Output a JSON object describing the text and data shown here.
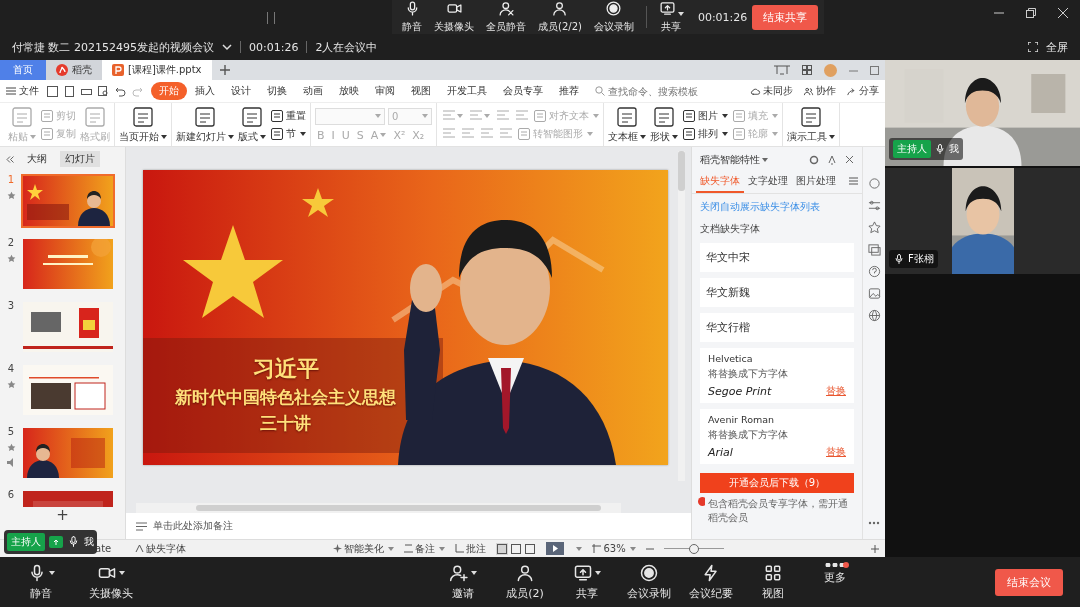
{
  "meeting_toolbar": {
    "buttons": [
      {
        "kind": "mic",
        "label": "静音",
        "dropdown": false
      },
      {
        "kind": "camera",
        "label": "关摄像头",
        "dropdown": false
      },
      {
        "kind": "mute_all",
        "label": "全员静音",
        "dropdown": false
      },
      {
        "kind": "members",
        "label": "成员(2/2)",
        "dropdown": false
      },
      {
        "kind": "record",
        "label": "会议录制",
        "dropdown": false
      },
      {
        "kind": "share",
        "label": "共享",
        "dropdown": true
      }
    ],
    "timer": "00:01:26",
    "end_button": "结束共享"
  },
  "meeting_info": {
    "title": "付常捷 数二 202152495发起的视频会议",
    "elapsed": "00:01:26",
    "participants": "2人在会议中",
    "fullscreen": "全屏"
  },
  "document_tabs": [
    {
      "kind": "home",
      "label": "首页",
      "selected": false
    },
    {
      "kind": "docer",
      "label": "稻壳",
      "selected": false
    },
    {
      "kind": "pptx",
      "label": "[课程]课件.pptx",
      "selected": true
    }
  ],
  "menu": {
    "file": "文件",
    "tabs": [
      {
        "label": "开始",
        "selected": true
      },
      {
        "label": "插入",
        "selected": false
      },
      {
        "label": "设计",
        "selected": false
      },
      {
        "label": "切换",
        "selected": false
      },
      {
        "label": "动画",
        "selected": false
      },
      {
        "label": "放映",
        "selected": false
      },
      {
        "label": "审阅",
        "selected": false
      },
      {
        "label": "视图",
        "selected": false
      },
      {
        "label": "开发工具",
        "selected": false
      },
      {
        "label": "会员专享",
        "selected": false
      },
      {
        "label": "推荐",
        "selected": false
      }
    ],
    "search": {
      "placeholder": "查找命令、搜索模板"
    },
    "actions": [
      {
        "kind": "cloud",
        "label": "未同步"
      },
      {
        "kind": "people",
        "label": "协作"
      },
      {
        "kind": "share",
        "label": "分享"
      }
    ]
  },
  "ribbon": [
    {
      "columns": [
        {
          "large": {
            "label": "粘贴",
            "dropdown": true,
            "disabled": true
          }
        },
        {
          "rows": [
            [
              {
                "kind": "button",
                "label": "剪切",
                "dropdown": false,
                "disabled": true
              }
            ],
            [
              {
                "kind": "button",
                "label": "复制",
                "dropdown": false,
                "disabled": true
              }
            ]
          ]
        },
        {
          "large": {
            "label": "格式刷",
            "dropdown": false,
            "disabled": true
          }
        }
      ]
    },
    {
      "columns": [
        {
          "large": {
            "label": "当页开始",
            "dropdown": true,
            "disabled": false
          }
        }
      ]
    },
    {
      "columns": [
        {
          "large": {
            "label": "新建幻灯片",
            "dropdown": true,
            "disabled": false
          }
        },
        {
          "large": {
            "label": "版式",
            "dropdown": true,
            "disabled": false
          }
        },
        {
          "rows": [
            [
              {
                "kind": "button",
                "label": "重置",
                "dropdown": false,
                "disabled": false
              }
            ],
            [
              {
                "kind": "button",
                "label": "节",
                "dropdown": true,
                "disabled": false
              }
            ]
          ]
        }
      ]
    },
    {
      "columns": [
        {
          "top": [
            {
              "kind": "font_field",
              "dropdown": true,
              "disabled": true
            },
            {
              "kind": "size_field",
              "label": "0",
              "dropdown": true,
              "disabled": true
            }
          ],
          "bottom": [
            {
              "kind": "glyph",
              "label": "B",
              "dropdown": false,
              "disabled": true
            },
            {
              "kind": "glyph",
              "label": "I",
              "dropdown": false,
              "disabled": true
            },
            {
              "kind": "glyph",
              "label": "U",
              "dropdown": false,
              "disabled": true
            },
            {
              "kind": "glyph",
              "label": "S",
              "dropdown": false,
              "disabled": true
            },
            {
              "kind": "glyph",
              "label": "A",
              "dropdown": true,
              "disabled": true
            },
            {
              "kind": "glyph",
              "label": "X²",
              "dropdown": false,
              "disabled": true
            },
            {
              "kind": "glyph",
              "label": "X₂",
              "dropdown": false,
              "disabled": true
            }
          ]
        }
      ]
    },
    {
      "columns": [
        {
          "rows": [
            [
              {
                "kind": "icon",
                "dropdown": true,
                "disabled": true
              },
              {
                "kind": "icon",
                "dropdown": true,
                "disabled": true
              },
              {
                "kind": "icon",
                "dropdown": false,
                "disabled": true
              },
              {
                "kind": "icon",
                "dropdown": false,
                "disabled": true
              },
              {
                "kind": "button",
                "label": "对齐文本",
                "dropdown": true,
                "disabled": true
              }
            ],
            [
              {
                "kind": "icon",
                "dropdown": false,
                "disabled": true
              },
              {
                "kind": "icon",
                "dropdown": false,
                "disabled": true
              },
              {
                "kind": "icon",
                "dropdown": false,
                "disabled": true
              },
              {
                "kind": "icon",
                "dropdown": false,
                "disabled": true
              },
              {
                "kind": "button",
                "label": "转智能图形",
                "dropdown": true,
                "disabled": true
              }
            ]
          ]
        }
      ]
    },
    {
      "columns": [
        {
          "large": {
            "label": "文本框",
            "dropdown": true,
            "disabled": false
          }
        },
        {
          "large": {
            "label": "形状",
            "dropdown": true,
            "disabled": false
          }
        },
        {
          "rows": [
            [
              {
                "kind": "button",
                "label": "图片",
                "dropdown": true,
                "disabled": false
              }
            ],
            [
              {
                "kind": "button",
                "label": "排列",
                "dropdown": true,
                "disabled": false
              }
            ]
          ]
        },
        {
          "rows": [
            [
              {
                "kind": "button",
                "label": "填充",
                "dropdown": true,
                "disabled": true
              }
            ],
            [
              {
                "kind": "button",
                "label": "轮廓",
                "dropdown": true,
                "disabled": true
              }
            ]
          ]
        }
      ]
    },
    {
      "columns": [
        {
          "large": {
            "label": "演示工具",
            "dropdown": true,
            "disabled": false
          }
        }
      ]
    }
  ],
  "slide_panel": {
    "tabs": [
      {
        "label": "大纲",
        "selected": false
      },
      {
        "label": "幻灯片",
        "selected": true
      }
    ],
    "slides": [
      {
        "number": "1",
        "selected": true,
        "animated": true,
        "audio": false
      },
      {
        "number": "2",
        "selected": false,
        "animated": true,
        "audio": false
      },
      {
        "number": "3",
        "selected": false,
        "animated": false,
        "audio": false
      },
      {
        "number": "4",
        "selected": false,
        "animated": true,
        "audio": false
      },
      {
        "number": "5",
        "selected": false,
        "animated": true,
        "audio": true
      },
      {
        "number": "6",
        "selected": false
      }
    ],
    "add_button": "+"
  },
  "slide": {
    "lines": [
      "习近平",
      "新时代中国特色社会主义思想",
      "三十讲"
    ]
  },
  "notes_placeholder": "单击此处添加备注",
  "font_pane": {
    "title": "稻壳智能特性",
    "tabs": [
      {
        "label": "缺失字体",
        "selected": true
      },
      {
        "label": "文字处理",
        "selected": false
      },
      {
        "label": "图片处理",
        "selected": false
      }
    ],
    "link": "关闭自动展示缺失字体列表",
    "section": "文档缺失字体",
    "missing_fonts": [
      "华文中宋",
      "华文新魏",
      "华文行楷"
    ],
    "replacements": [
      {
        "from": "Helvetica",
        "note": "将替换成下方字体",
        "to": "Segoe Print",
        "action": "替换"
      },
      {
        "from": "Avenir Roman",
        "note": "将替换成下方字体",
        "to": "Arial",
        "action": "替换"
      }
    ],
    "download_button": "开通会员后下载（9）",
    "footer": "包含稻壳会员专享字体，需开通稻壳会员"
  },
  "status_bar": {
    "partial_text": "ate",
    "missing_fonts": "缺失字体",
    "beautify": "智能美化",
    "notes": "备注",
    "comments": "批注",
    "view_modes": [
      {
        "selected": true
      },
      {
        "selected": false
      },
      {
        "selected": false
      }
    ],
    "zoom": "63%",
    "zoom_slider": {
      "level": 0.5
    }
  },
  "floating_badge": {
    "badge": "主持人",
    "name": "我"
  },
  "participants": [
    {
      "badge": "主持人",
      "name": "我"
    },
    {
      "name": "F张栩"
    }
  ],
  "meeting_bottom": {
    "left": [
      {
        "kind": "mic",
        "label": "静音",
        "dropdown": true,
        "notification": false
      },
      {
        "kind": "camera",
        "label": "关摄像头",
        "dropdown": true,
        "notification": false
      }
    ],
    "center": [
      {
        "kind": "invite",
        "label": "邀请",
        "dropdown": true,
        "notification": false
      },
      {
        "kind": "members",
        "label": "成员(2)",
        "dropdown": false,
        "notification": false
      },
      {
        "kind": "share",
        "label": "共享",
        "dropdown": true,
        "notification": false
      },
      {
        "kind": "record",
        "label": "会议录制",
        "dropdown": false,
        "notification": false
      },
      {
        "kind": "minutes",
        "label": "会议纪要",
        "dropdown": false,
        "notification": false
      },
      {
        "kind": "view",
        "label": "视图",
        "dropdown": false,
        "notification": false
      },
      {
        "kind": "more",
        "label": "更多",
        "dropdown": false,
        "notification": true
      }
    ],
    "end_button": "结束会议"
  }
}
